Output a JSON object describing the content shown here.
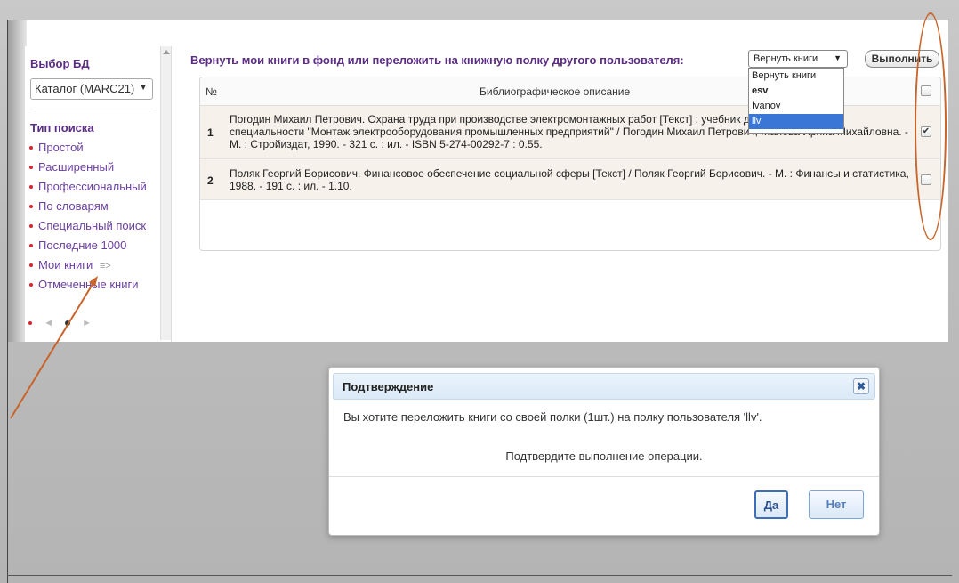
{
  "sidebar": {
    "db_title": "Выбор БД",
    "db_select_value": "Каталог (MARC21)",
    "search_type_title": "Тип поиска",
    "items": [
      {
        "label": "Простой"
      },
      {
        "label": "Расширенный"
      },
      {
        "label": "Профессиональный"
      },
      {
        "label": "По словарям"
      },
      {
        "label": "Специальный поиск"
      },
      {
        "label": "Последние 1000"
      },
      {
        "label": "Мои книги",
        "suffix": "≡>"
      },
      {
        "label": "Отмеченные книги"
      }
    ],
    "pager": {
      "prev": "◄",
      "next": "►"
    }
  },
  "main": {
    "action_label": "Вернуть мои книги в фонд или переложить на книжную полку другого пользователя:",
    "return_select_value": "Вернуть книги",
    "execute_button": "Выполнить",
    "dropdown_options": [
      "Вернуть книги",
      "esv",
      "Ivanov",
      "llv"
    ],
    "dropdown_selected": "llv",
    "table": {
      "headers": {
        "num": "№",
        "description": "Библиографическое описание"
      },
      "rows": [
        {
          "num": "1",
          "description": "Погодин Михаил Петрович. Охрана труда при производстве электромонтажных работ [Текст] : учебник для техникумов по специальности \"Монтаж электрооборудования промышленных предприятий\" / Погодин Михаил Петрович, Малова Ирина Михайловна. - М. : Стройиздат, 1990. - 321 с. : ил. - ISBN 5-274-00292-7 : 0.55.",
          "checked": true
        },
        {
          "num": "2",
          "description": "Поляк Георгий Борисович. Финансовое обеспечение социальной сферы [Текст] / Поляк Георгий Борисович. - М. : Финансы и статистика, 1988. - 191 с. : ил. - 1.10.",
          "checked": false
        }
      ]
    }
  },
  "dialog": {
    "title": "Подтверждение",
    "message": "Вы хотите переложить книги со своей полки (1шт.) на полку пользователя 'llv'.",
    "sub_message": "Подтвердите выполнение операции.",
    "yes_button": "Да",
    "no_button": "Нет",
    "close_symbol": "✖"
  },
  "colors": {
    "accent_purple": "#5a2d82",
    "link_purple": "#6b3fa0",
    "annotation_orange": "#c8642a",
    "selection_blue": "#3a76d6"
  }
}
